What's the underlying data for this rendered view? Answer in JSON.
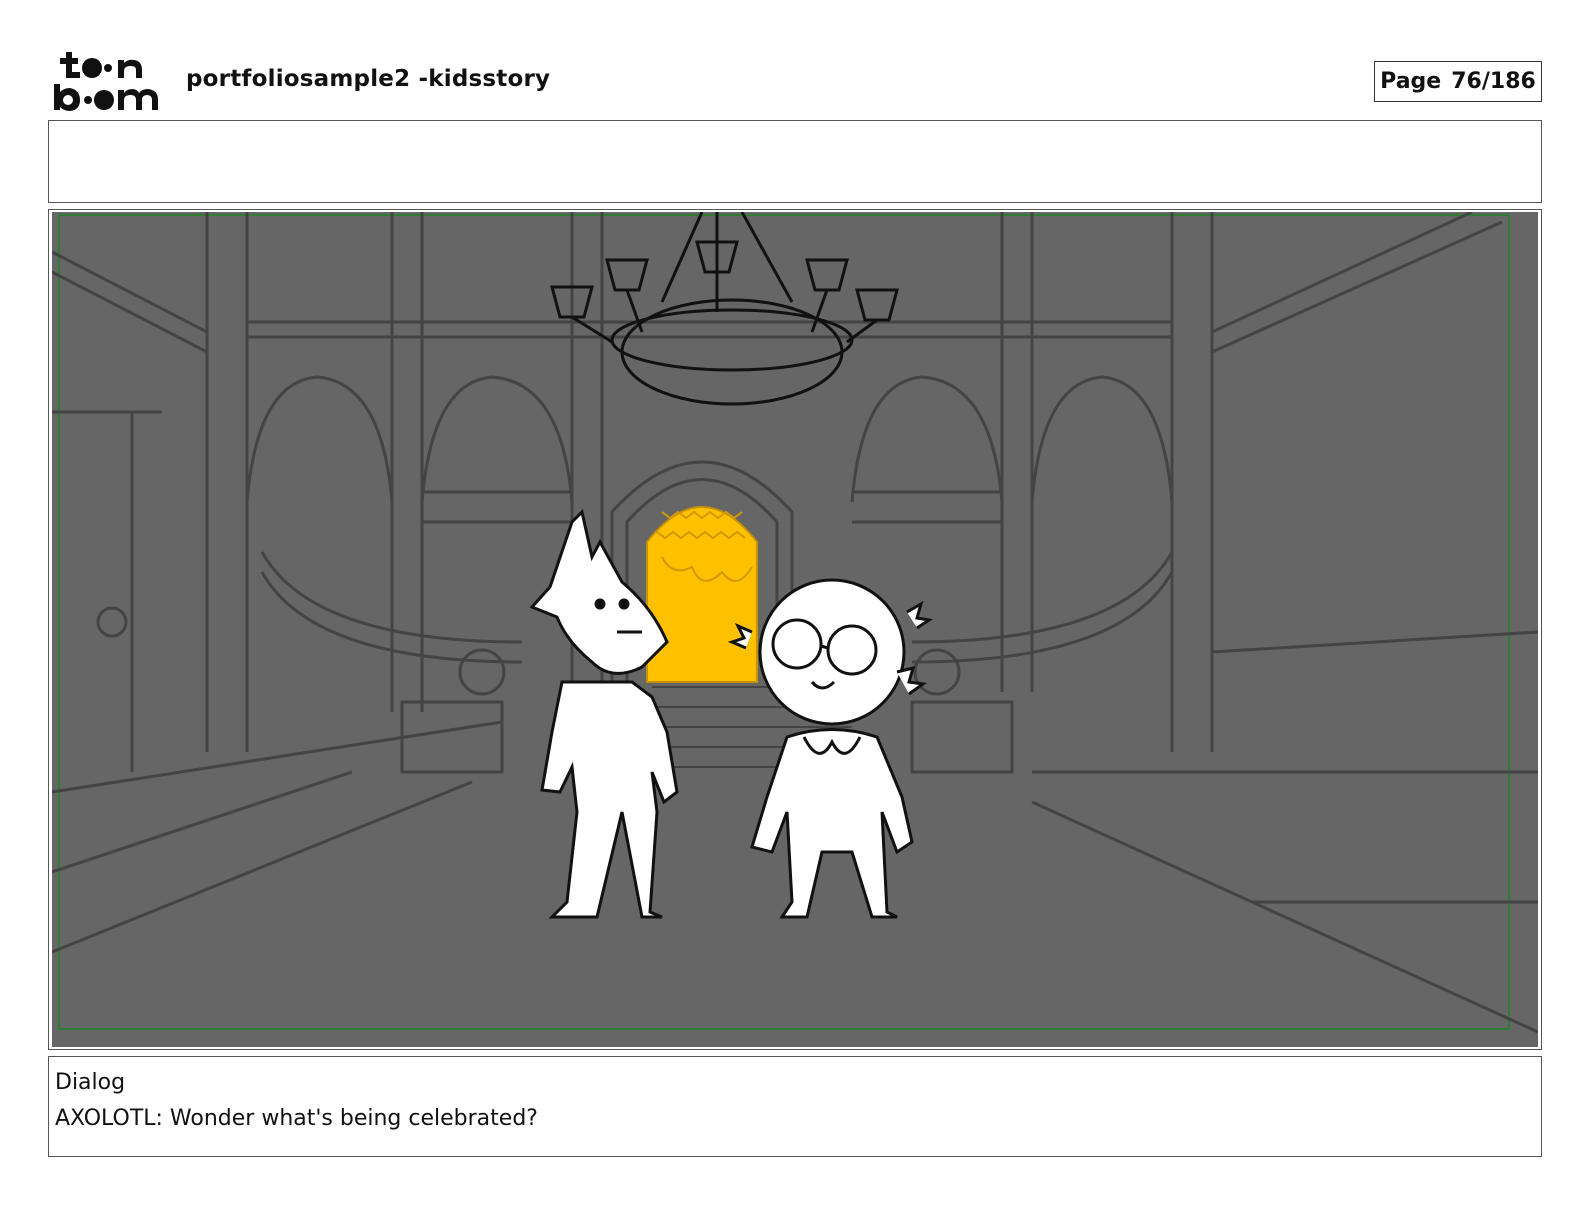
{
  "header": {
    "logo_text": "toonboom",
    "project_title": "portfoliosample2 -kidsstory",
    "page_label": "Page",
    "page_number": "76/186"
  },
  "notes": {
    "text": ""
  },
  "panel": {
    "background_color": "#666666",
    "frame_color": "#2e7d32",
    "door_color": "#ffc000",
    "icons": [
      "chandelier-icon",
      "fox-character",
      "axolotl-character",
      "glowing-door"
    ]
  },
  "dialog": {
    "heading": "Dialog",
    "line": "AXOLOTL: Wonder what's being celebrated?"
  }
}
